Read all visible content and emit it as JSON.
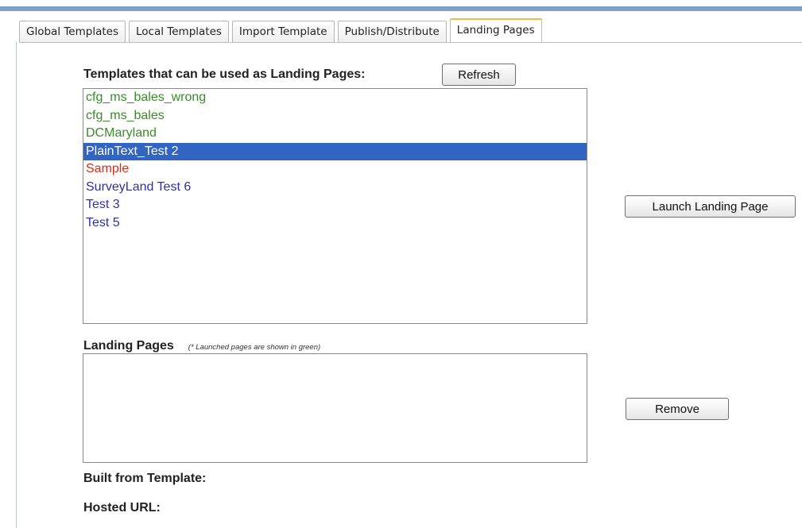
{
  "tabs": [
    {
      "label": "Global Templates",
      "active": false
    },
    {
      "label": "Local Templates",
      "active": false
    },
    {
      "label": "Import Template",
      "active": false
    },
    {
      "label": "Publish/Distribute",
      "active": false
    },
    {
      "label": "Landing Pages",
      "active": true
    }
  ],
  "templates_section": {
    "heading": "Templates that can be used as Landing Pages:",
    "refresh_label": "Refresh",
    "items": [
      {
        "label": "cfg_ms_bales_wrong",
        "color": "green",
        "selected": false
      },
      {
        "label": "cfg_ms_bales",
        "color": "green",
        "selected": false
      },
      {
        "label": "DCMaryland",
        "color": "green",
        "selected": false
      },
      {
        "label": "PlainText_Test 2",
        "color": "blue",
        "selected": true
      },
      {
        "label": "Sample",
        "color": "red",
        "selected": false
      },
      {
        "label": "SurveyLand Test 6",
        "color": "blue",
        "selected": false
      },
      {
        "label": "Test 3",
        "color": "blue",
        "selected": false
      },
      {
        "label": "Test 5",
        "color": "blue",
        "selected": false
      }
    ]
  },
  "launch_label": "Launch Landing Page",
  "landing_section": {
    "heading": "Landing Pages",
    "hint": "(* Launched pages are shown in green)",
    "items": []
  },
  "remove_label": "Remove",
  "built_from_label": "Built from Template:",
  "hosted_url_label": "Hosted URL:",
  "colors": {
    "accent_bar": "#7f9ec9",
    "active_tab_top": "#f5b846",
    "selection": "#3165c4",
    "green": "#3a8c2a",
    "red": "#d42d1a",
    "blue": "#3030a8"
  }
}
